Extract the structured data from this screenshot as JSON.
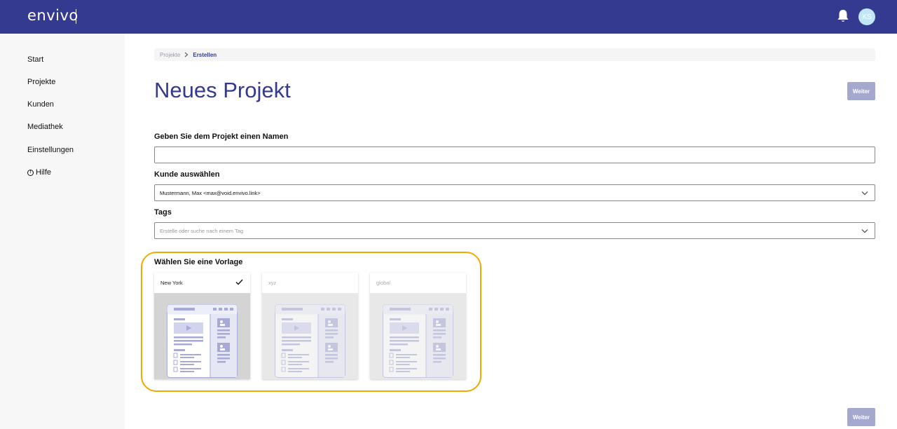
{
  "header": {
    "logo": "envivo",
    "avatar_initials": "KS"
  },
  "sidebar": {
    "items": [
      {
        "label": "Start"
      },
      {
        "label": "Projekte"
      },
      {
        "label": "Kunden"
      },
      {
        "label": "Mediathek"
      },
      {
        "label": "Einstellungen"
      },
      {
        "label": "Hilfe",
        "icon": "help-circle-icon"
      }
    ]
  },
  "breadcrumb": {
    "parent": "Projekte",
    "current": "Erstellen"
  },
  "page": {
    "title": "Neues Projekt",
    "next_label": "Weiter"
  },
  "form": {
    "name_label": "Geben Sie dem Projekt einen Namen",
    "name_value": "",
    "customer_label": "Kunde auswählen",
    "customer_value": "Mustermann, Max <max@void.envivo.link>",
    "tags_label": "Tags",
    "tags_placeholder": "Erstelle oder suche nach einem Tag"
  },
  "templates": {
    "title": "Wählen Sie eine Vorlage",
    "items": [
      {
        "name": "New York",
        "selected": true
      },
      {
        "name": "xyz",
        "selected": false
      },
      {
        "name": "global",
        "selected": false
      }
    ]
  },
  "colors": {
    "brand": "#333a8f",
    "highlight": "#f2a900",
    "button_disabled": "#a6a9cf"
  }
}
